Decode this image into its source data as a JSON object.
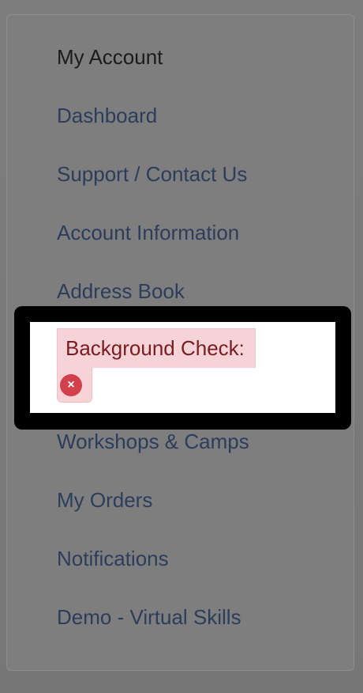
{
  "menu": {
    "heading": "My Account",
    "items": [
      {
        "label": "Dashboard"
      },
      {
        "label": "Support / Contact Us"
      },
      {
        "label": "Account Information"
      },
      {
        "label": "Address Book"
      },
      {
        "label": "Workshops & Camps"
      },
      {
        "label": "My Orders"
      },
      {
        "label": "Notifications"
      },
      {
        "label": "Demo - Virtual Skills"
      }
    ]
  },
  "highlight": {
    "badge_text": "Background Check:",
    "icon": "error-x-icon",
    "icon_glyph": "×"
  },
  "colors": {
    "link": "#2c3d5c",
    "badge_bg": "#f5d3d6",
    "badge_text": "#7a1c24",
    "error_icon": "#d2414b"
  }
}
